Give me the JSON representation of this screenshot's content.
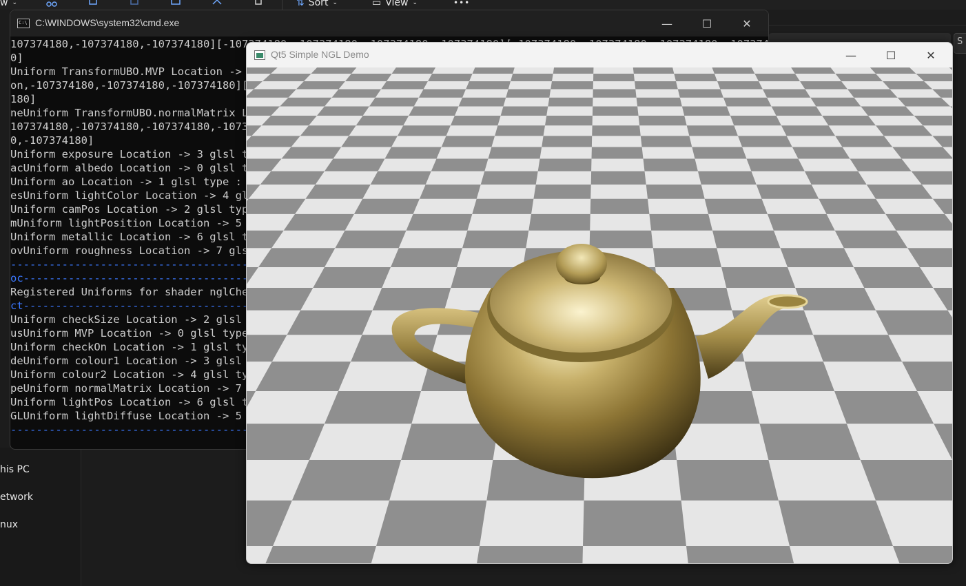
{
  "explorer": {
    "toolbar": {
      "partial_left": "w",
      "sort_label": "Sort",
      "view_label": "View",
      "more_label": "•••"
    },
    "sidebar_items": [
      "his PC",
      "etwork",
      "nux"
    ]
  },
  "cmd": {
    "title": "C:\\WINDOWS\\system32\\cmd.exe",
    "minimize": "—",
    "maximize": "☐",
    "close": "✕",
    "lines": [
      {
        "text": "107374180,-107374180,-107374180][-107374180,-107374180,-107374180,-107374180][-107374180,-107374180,-107374180,-1073741",
        "sep": false
      },
      {
        "text": "0]",
        "sep": false
      },
      {
        "text": "Uniform TransformUBO.MVP Location -> -",
        "sep": false
      },
      {
        "text": "on,-107374180,-107374180,-107374180][-10",
        "sep": false
      },
      {
        "text": "180]",
        "sep": false
      },
      {
        "text": "neUniform TransformUBO.normalMatrix Loca",
        "sep": false
      },
      {
        "text": "107374180,-107374180,-107374180,-10737",
        "sep": false
      },
      {
        "text": "0,-107374180]",
        "sep": false
      },
      {
        "text": "Uniform exposure Location -> 3 glsl ty",
        "sep": false
      },
      {
        "text": "acUniform albedo Location -> 0 glsl type",
        "sep": false
      },
      {
        "text": "Uniform ao Location -> 1 glsl type : f",
        "sep": false
      },
      {
        "text": "esUniform lightColor Location -> 4 glsl",
        "sep": false
      },
      {
        "text": "Uniform camPos Location -> 2 glsl type",
        "sep": false
      },
      {
        "text": "mUniform lightPosition Location -> 5 gl",
        "sep": false
      },
      {
        "text": "Uniform metallic Location -> 6 glsl ty",
        "sep": false
      },
      {
        "text": "ovUniform roughness Location -> 7 glsl t",
        "sep": false
      },
      {
        "text": "----------------------------------------",
        "sep": true
      },
      {
        "text": "oc--------------------------------------",
        "sep": true
      },
      {
        "text": "Registered Uniforms for shader nglChec",
        "sep": false
      },
      {
        "text": "ct--------------------------------------",
        "sep": true
      },
      {
        "text": "Uniform checkSize Location -> 2 glsl t",
        "sep": false
      },
      {
        "text": "usUniform MVP Location -> 0 glsl type :",
        "sep": false
      },
      {
        "text": "Uniform checkOn Location -> 1 glsl typ",
        "sep": false
      },
      {
        "text": "deUniform colour1 Location -> 3 glsl typ",
        "sep": false
      },
      {
        "text": "Uniform colour2 Location -> 4 glsl typ",
        "sep": false
      },
      {
        "text": "peUniform normalMatrix Location -> 7 gls",
        "sep": false
      },
      {
        "text": "Uniform lightPos Location -> 6 glsl ty",
        "sep": false
      },
      {
        "text": "GLUniform lightDiffuse Location -> 5 gls",
        "sep": false
      },
      {
        "text": "----------------------------------------",
        "sep": true
      }
    ]
  },
  "ngl": {
    "title": "Qt5 Simple NGL Demo",
    "minimize": "—",
    "maximize": "☐",
    "close": "✕",
    "colors": {
      "checker_light": "#e6e6e6",
      "checker_dark": "#8f8f8f",
      "teapot_highlight": "#f2e6b0",
      "teapot_mid": "#a8924c",
      "teapot_shadow": "#3a2f12"
    }
  }
}
